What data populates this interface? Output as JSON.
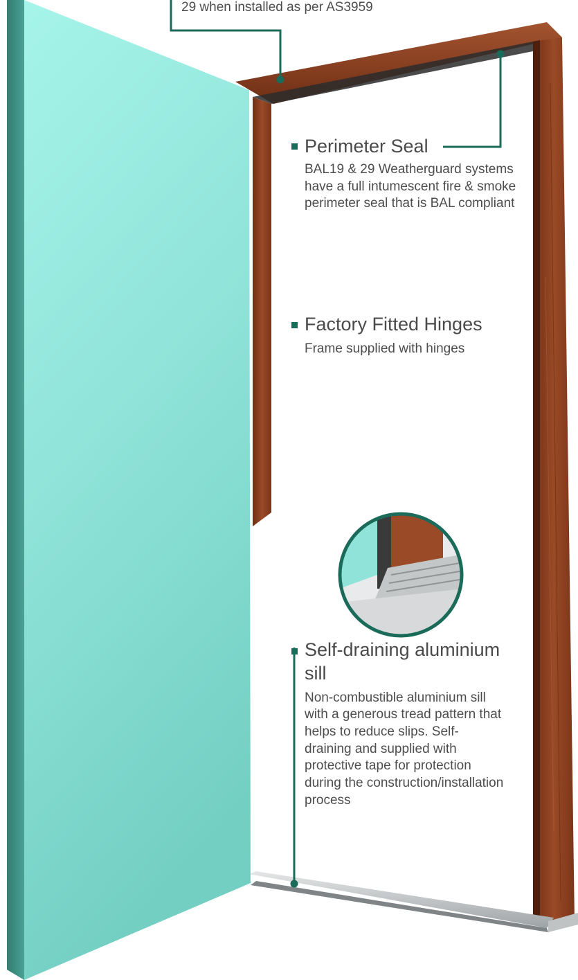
{
  "top_note": "29 when installed as per AS3959",
  "features": [
    {
      "title": "Perimeter Seal",
      "description": "BAL19 & 29 Weatherguard systems have a full intumescent fire & smoke perimeter seal that is BAL compliant"
    },
    {
      "title": "Factory Fitted Hinges",
      "description": "Frame supplied with hinges"
    },
    {
      "title": "Self-draining aluminium sill",
      "description": "Non-combustible aluminium sill with a generous tread pattern that helps to reduce slips. Self-draining and supplied with protective tape for protection during the construction/installation process"
    }
  ],
  "colors": {
    "door_panel": "#8fe6da",
    "frame_timber": "#8a3d1f",
    "accent": "#1b6b5a",
    "sill": "#c9cbcc"
  }
}
